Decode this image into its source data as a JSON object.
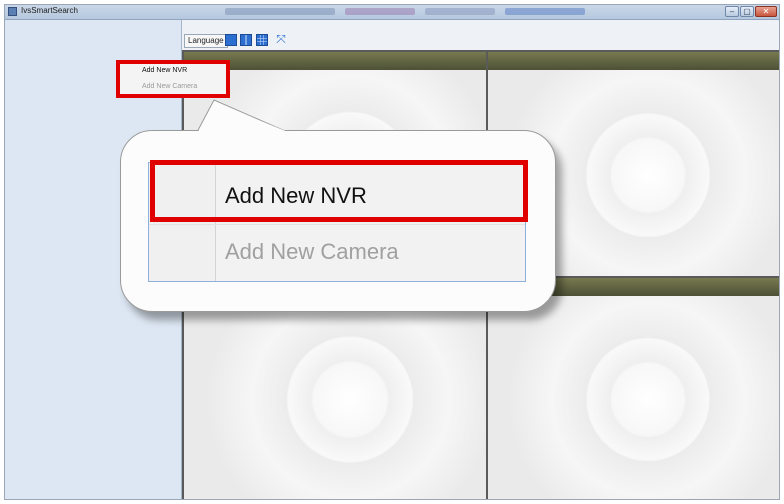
{
  "window": {
    "title": "IvsSmartSearch",
    "controls": {
      "minimize": "–",
      "maximize": "▢",
      "close": "✕"
    }
  },
  "toolbar": {
    "language_label": "Language",
    "layout_icons": [
      "single-view-icon",
      "two-by-two-view-icon",
      "three-by-three-view-icon",
      "fullscreen-icon"
    ],
    "fullscreen_glyph": "⤧"
  },
  "context_menu": {
    "items": [
      {
        "label": "Add New NVR",
        "enabled": true
      },
      {
        "label": "Add New Camera",
        "enabled": false
      }
    ]
  },
  "callout_menu": {
    "items": [
      {
        "label": "Add New NVR",
        "enabled": true
      },
      {
        "label": "Add New Camera",
        "enabled": false
      }
    ]
  },
  "colors": {
    "highlight": "#e00000",
    "accent": "#2c6fd1",
    "camera_bar": "#5f6140"
  }
}
